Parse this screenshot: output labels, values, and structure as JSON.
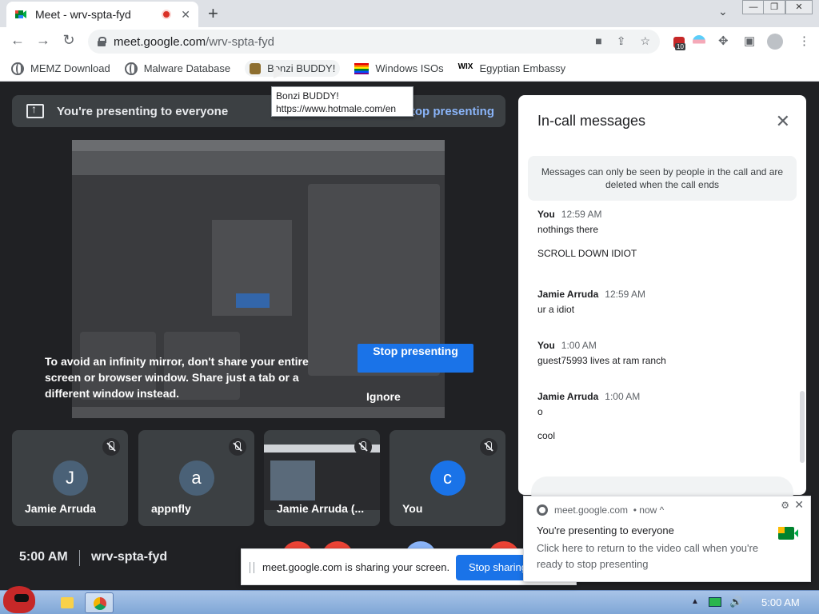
{
  "browser": {
    "tab_title": "Meet - wrv-spta-fyd",
    "tab_close": "✕",
    "new_tab": "+",
    "tab_search": "⌄",
    "window_controls": [
      "—",
      "❐",
      "✕"
    ],
    "url_host": "meet.google.com",
    "url_path": "/wrv-spta-fyd",
    "extension_badge": "10"
  },
  "bookmarks": [
    {
      "label": "MEMZ Download",
      "icon": "globe-icon"
    },
    {
      "label": "Malware Database",
      "icon": "globe-icon"
    },
    {
      "label": "Bonzi BUDDY!",
      "icon": "bonzi-icon"
    },
    {
      "label": "Windows ISOs",
      "icon": "rainbow-flag-icon"
    },
    {
      "label": "Egyptian Embassy",
      "icon": "wix-icon",
      "icon_text": "WIX"
    }
  ],
  "tooltip": {
    "title": "Bonzi BUDDY!",
    "url": "https://www.hotmale.com/en"
  },
  "meet": {
    "presenting_banner": "You're presenting to everyone",
    "banner_stop": "Stop presenting",
    "infinity_warning": "To avoid an infinity mirror, don't share your entire screen or browser window. Share just a tab or a different window instead.",
    "stop_presenting_button": "Stop presenting",
    "ignore_button": "Ignore",
    "participants": [
      {
        "initial": "J",
        "name": "Jamie Arruda",
        "color": "#4a6177"
      },
      {
        "initial": "a",
        "name": "appnfly",
        "color": "#4a6177"
      },
      {
        "initial": "",
        "name": "Jamie Arruda (...",
        "color": ""
      },
      {
        "initial": "c",
        "name": "You",
        "color": "#1a73e8"
      }
    ],
    "clock": "5:00 AM",
    "meeting_code": "wrv-spta-fyd"
  },
  "chat": {
    "title": "In-call messages",
    "close": "✕",
    "notice": "Messages can only be seen by people in the call and are deleted when the call ends",
    "messages": [
      {
        "sender": "You",
        "time": "12:59 AM",
        "lines": [
          "nothings there",
          "SCROLL DOWN IDIOT"
        ]
      },
      {
        "sender": "Jamie Arruda",
        "time": "12:59 AM",
        "lines": [
          "ur a idiot"
        ]
      },
      {
        "sender": "You",
        "time": "1:00 AM",
        "lines": [
          "guest75993 lives at ram ranch"
        ]
      },
      {
        "sender": "Jamie Arruda",
        "time": "1:00 AM",
        "lines": [
          "o",
          "cool"
        ]
      }
    ]
  },
  "notification": {
    "source": "meet.google.com",
    "when": "• now ^",
    "settings": "⚙",
    "close": "✕",
    "title": "You're presenting to everyone",
    "body": "Click here to return to the video call when you're ready to stop presenting"
  },
  "sharebar": {
    "text": "meet.google.com is sharing your screen.",
    "button": "Stop sharing"
  },
  "taskbar": {
    "time": "5:00 AM",
    "tray_up": "▲",
    "volume": "🔊"
  }
}
